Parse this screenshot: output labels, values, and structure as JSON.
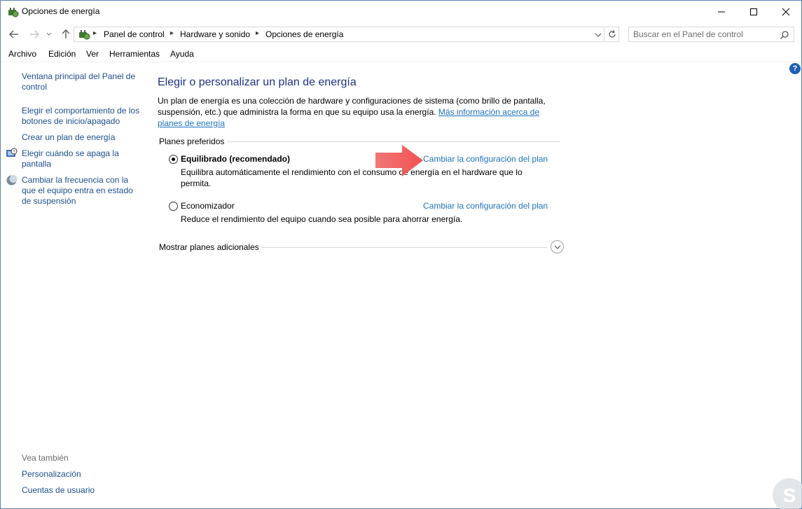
{
  "window": {
    "title": "Opciones de energía"
  },
  "address_bar": {
    "crumbs": [
      "Panel de control",
      "Hardware y sonido",
      "Opciones de energía"
    ]
  },
  "search": {
    "placeholder": "Buscar en el Panel de control"
  },
  "menu": {
    "items": [
      "Archivo",
      "Edición",
      "Ver",
      "Herramientas",
      "Ayuda"
    ]
  },
  "sidebar": {
    "links": [
      "Ventana principal del Panel de control",
      "Elegir el comportamiento de los botones de inicio/apagado",
      "Crear un plan de energía",
      "Elegir cuándo se apaga la pantalla",
      "Cambiar la frecuencia con la que el equipo entra en estado de suspensión"
    ],
    "see_also_label": "Vea también",
    "see_also": [
      "Personalización",
      "Cuentas de usuario"
    ]
  },
  "main": {
    "heading": "Elegir o personalizar un plan de energía",
    "description": "Un plan de energía es una colección de hardware y configuraciones de sistema (como brillo de pantalla, suspensión, etc.) que administra la forma en que su equipo usa la energía.",
    "more_info_link": "Más información acerca de planes de energía",
    "preferred_plans_label": "Planes preferidos",
    "plans": [
      {
        "name": "Equilibrado (recomendado)",
        "selected": true,
        "description": "Equilibra automáticamente el rendimiento con el consumo de energía en el hardware que lo permita.",
        "settings_link": "Cambiar la configuración del plan"
      },
      {
        "name": "Economizador",
        "selected": false,
        "description": "Reduce el rendimiento del equipo cuando sea posible para ahorrar energía.",
        "settings_link": "Cambiar la configuración del plan"
      }
    ],
    "show_more_label": "Mostrar planes adicionales"
  },
  "colors": {
    "link": "#1e73be",
    "heading": "#1e3287",
    "annotation_arrow": "#f05a5a",
    "help_icon": "#1f5fb5"
  }
}
